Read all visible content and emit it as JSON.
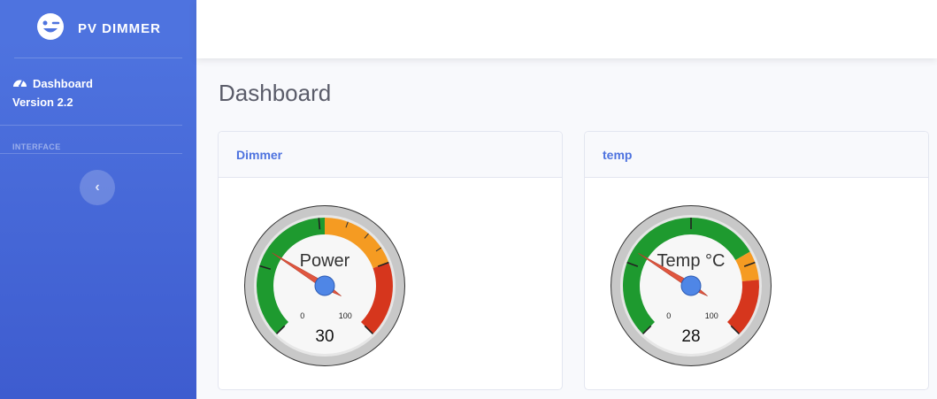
{
  "brand": {
    "name": "PV DIMMER",
    "icon": "wink-face-icon"
  },
  "sidebar": {
    "nav": {
      "label": "Dashboard",
      "icon": "tachometer-icon"
    },
    "version": "Version 2.2",
    "heading": "INTERFACE",
    "toggle_icon": "chevron-left-icon",
    "toggle_glyph": "‹"
  },
  "page": {
    "title": "Dashboard"
  },
  "cards": [
    {
      "title": "Dimmer",
      "gauge": {
        "label": "Power",
        "value": 30,
        "min": 0,
        "max": 100,
        "min_label": "0",
        "max_label": "100"
      }
    },
    {
      "title": "temp",
      "gauge": {
        "label": "Temp °C",
        "value": 28,
        "min": 0,
        "max": 100,
        "min_label": "0",
        "max_label": "100"
      }
    }
  ],
  "colors": {
    "primary": "#4e73df",
    "green": "#1e9a2f",
    "orange": "#f59b22",
    "red": "#d6361d",
    "needle": "#e0563f",
    "hub": "#4f86e6"
  }
}
